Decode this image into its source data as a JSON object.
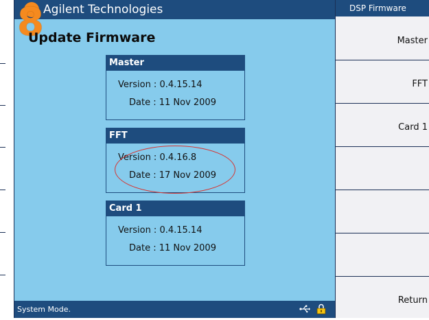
{
  "app": {
    "brand": "Agilent Technologies",
    "page_title": "Update Firmware",
    "badge_number": "8"
  },
  "panels": [
    {
      "name": "Master",
      "version": "Version : 0.4.15.14",
      "date": "Date : 11 Nov 2009"
    },
    {
      "name": "FFT",
      "version": "Version : 0.4.16.8",
      "date": "Date : 17 Nov 2009"
    },
    {
      "name": "Card 1",
      "version": "Version : 0.4.15.14",
      "date": "Date : 11 Nov 2009"
    }
  ],
  "status": {
    "text": "System Mode."
  },
  "softkeys": {
    "title": "DSP Firmware",
    "items": [
      "Master",
      "FFT",
      "Card 1",
      "",
      "",
      "",
      "Return"
    ]
  },
  "colors": {
    "accent_navy": "#1e4c7e",
    "screen_bg": "#86cbec",
    "annotation_red": "#d9322e",
    "badge_orange": "#f58a1f"
  }
}
